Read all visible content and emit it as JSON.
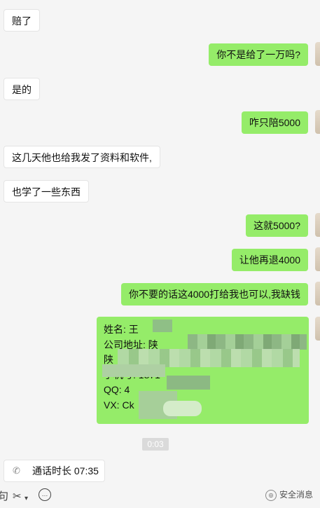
{
  "messages": [
    {
      "side": "left",
      "text": "赔了"
    },
    {
      "side": "right",
      "text": "你不是给了一万吗?"
    },
    {
      "side": "left",
      "text": "是的"
    },
    {
      "side": "right",
      "text": "咋只陪5000"
    },
    {
      "side": "left",
      "text": "这几天他也给我发了资料和软件,"
    },
    {
      "side": "left",
      "text": "也学了一些东西"
    },
    {
      "side": "right",
      "text": "这就5000?"
    },
    {
      "side": "right",
      "text": "让他再退4000"
    },
    {
      "side": "right",
      "text": "你不要的话这4000打给我也可以,我缺钱"
    }
  ],
  "contact_card": {
    "name": "姓名: 王",
    "company": "公司地址: 陕",
    "line3": "",
    "line4": "陕",
    "phone": "手机号: 1871",
    "qq": "QQ: 4",
    "wx": "VX: Ck"
  },
  "timestamp": "0:03",
  "call": {
    "label": "通话时长 07:35"
  },
  "toolbar": {
    "partial_glyph": "句",
    "scissors": "✂",
    "caret": "▾",
    "chat": "…"
  },
  "watermark": "安全消息"
}
